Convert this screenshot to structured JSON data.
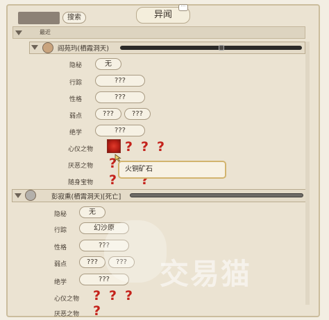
{
  "header": {
    "search_label": "搜索",
    "title": "异闻",
    "bubble": "···",
    "recent_label": "最近"
  },
  "characters": [
    {
      "name": "阎苑玙(栖霞洞天)",
      "status": "",
      "fields": {
        "yinmi_label": "隐秘",
        "yinmi_value": "无",
        "xingzong_label": "行踪",
        "xingzong_value": "???",
        "xingge_label": "性格",
        "xingge_value": "???",
        "ruodian_label": "弱点",
        "ruodian_value_1": "???",
        "ruodian_value_2": "???",
        "juexue_label": "绝学",
        "juexue_value": "???",
        "xinyi_label": "心仪之物",
        "yanwu_label": "厌恶之物",
        "suishen_label": "随身宝物"
      },
      "question_mark": "?"
    },
    {
      "name": "彭寂熏(栖霄洞天)[死亡]",
      "fields": {
        "yinmi_label": "隐秘",
        "yinmi_value": "无",
        "xingzong_label": "行踪",
        "xingzong_value": "幻沙原",
        "xingge_label": "性格",
        "xingge_value": "???",
        "ruodian_label": "弱点",
        "ruodian_value_1": "???",
        "ruodian_value_2": "???",
        "juexue_label": "绝学",
        "juexue_value": "???",
        "xinyi_label": "心仪之物",
        "yanwu_label": "厌恶之物"
      },
      "question_mark": "?"
    }
  ],
  "tooltip": {
    "text": "火铜矿石"
  },
  "watermark": {
    "text": "交易猫"
  }
}
